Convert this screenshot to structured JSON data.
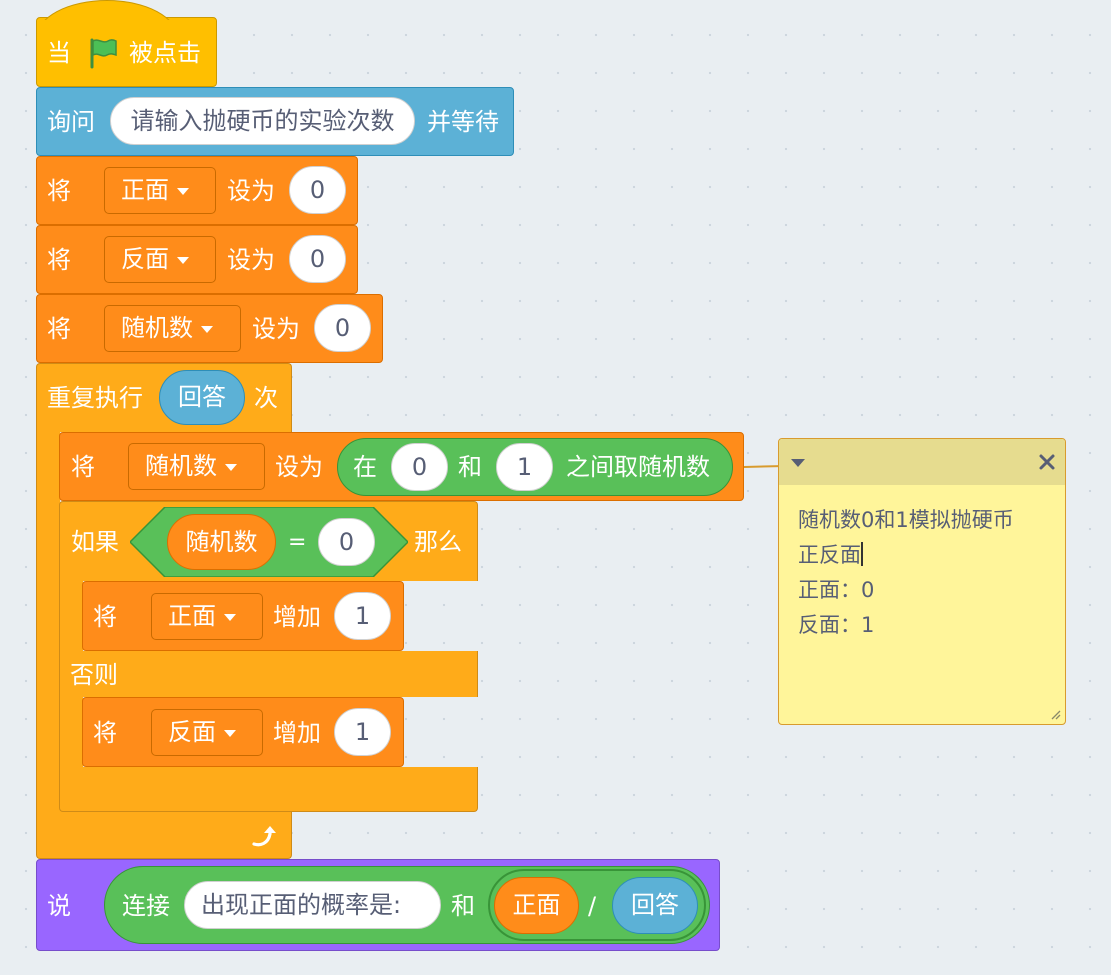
{
  "blocks": {
    "when_flag": {
      "prefix": "当",
      "suffix": "被点击"
    },
    "ask": {
      "label": "询问",
      "question": "请输入抛硬币的实验次数",
      "suffix": "并等待"
    },
    "set_heads": {
      "label": "将",
      "variable": "正面",
      "set_to": "设为",
      "value": "0"
    },
    "set_tails": {
      "label": "将",
      "variable": "反面",
      "set_to": "设为",
      "value": "0"
    },
    "set_random": {
      "label": "将",
      "variable": "随机数",
      "set_to": "设为",
      "value": "0"
    },
    "repeat": {
      "label": "重复执行",
      "times_reporter": "回答",
      "suffix": "次"
    },
    "set_random_inner": {
      "label": "将",
      "variable": "随机数",
      "set_to": "设为",
      "pick_random": {
        "prefix": "在",
        "from": "0",
        "and": "和",
        "to": "1",
        "suffix": "之间取随机数"
      }
    },
    "if_else": {
      "if": "如果",
      "then": "那么",
      "else": "否则",
      "condition": {
        "left": "随机数",
        "operator": "=",
        "right": "0"
      }
    },
    "change_heads": {
      "label": "将",
      "variable": "正面",
      "change_by": "增加",
      "value": "1"
    },
    "change_tails": {
      "label": "将",
      "variable": "反面",
      "change_by": "增加",
      "value": "1"
    },
    "say": {
      "label": "说",
      "join": "连接",
      "text": "出现正面的概率是:",
      "and": "和",
      "numerator": "正面",
      "divide": "/",
      "denominator": "回答"
    }
  },
  "comment": {
    "lines": [
      "随机数0和1模拟抛硬币",
      "正反面",
      "正面：0",
      "反面：1"
    ]
  },
  "colors": {
    "events": "#ffbf00",
    "sensing": "#5cb1d6",
    "variables": "#ff8c1a",
    "control": "#ffab19",
    "looks": "#9966ff",
    "operators": "#59c059",
    "comment": "#fff59a"
  }
}
